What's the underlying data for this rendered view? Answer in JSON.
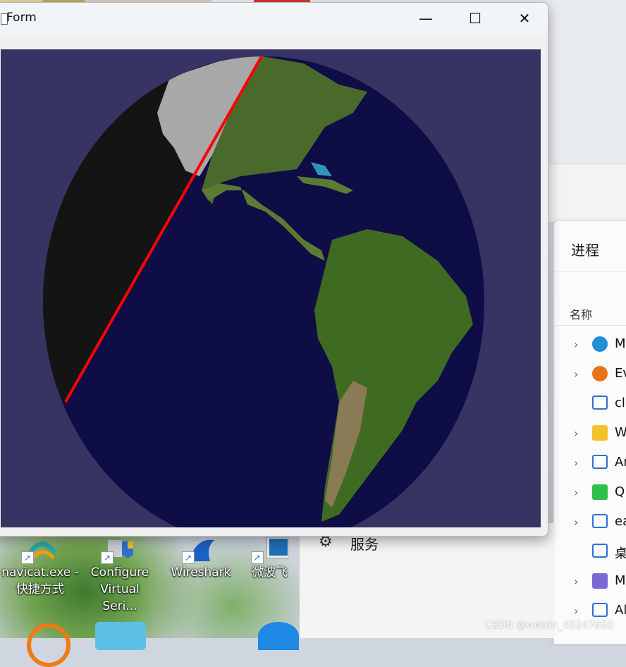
{
  "window": {
    "title": "Form",
    "controls": {
      "minimize": "—",
      "maximize": "☐",
      "close": "✕"
    },
    "client_bg": "#373363",
    "globe": {
      "ocean": "#0f0d45",
      "night": "#141414",
      "terminator": "#ff0000"
    }
  },
  "task_manager": {
    "title": "进程",
    "column_header": "名称",
    "rows": [
      {
        "label": "M",
        "icon": "edge-icon",
        "expandable": true
      },
      {
        "label": "Ev",
        "icon": "search-app-icon",
        "expandable": true
      },
      {
        "label": "cl",
        "icon": "app-window-icon",
        "expandable": false
      },
      {
        "label": "W",
        "icon": "folder-icon",
        "expandable": true
      },
      {
        "label": "Ar",
        "icon": "app-window-icon",
        "expandable": true
      },
      {
        "label": "Q",
        "icon": "qc-icon",
        "expandable": true
      },
      {
        "label": "ea",
        "icon": "app-window-icon",
        "expandable": true
      },
      {
        "label": "桌",
        "icon": "app-window-icon",
        "expandable": false
      },
      {
        "label": "M",
        "icon": "teams-icon",
        "expandable": true
      },
      {
        "label": "Al",
        "icon": "app-window-icon",
        "expandable": true
      }
    ]
  },
  "services": {
    "label": "服务"
  },
  "desktop_icons": [
    {
      "line1": "navicat.exe -",
      "line2": "快捷方式",
      "icon": "navicat-icon"
    },
    {
      "line1": "Configure",
      "line2": "Virtual Seri...",
      "icon": "configure-icon"
    },
    {
      "line1": "Wireshark",
      "line2": "",
      "icon": "wireshark-icon"
    },
    {
      "line1": "微波飞",
      "line2": "",
      "icon": "app-icon"
    }
  ],
  "watermark": "CSDN @weixin_45247650"
}
